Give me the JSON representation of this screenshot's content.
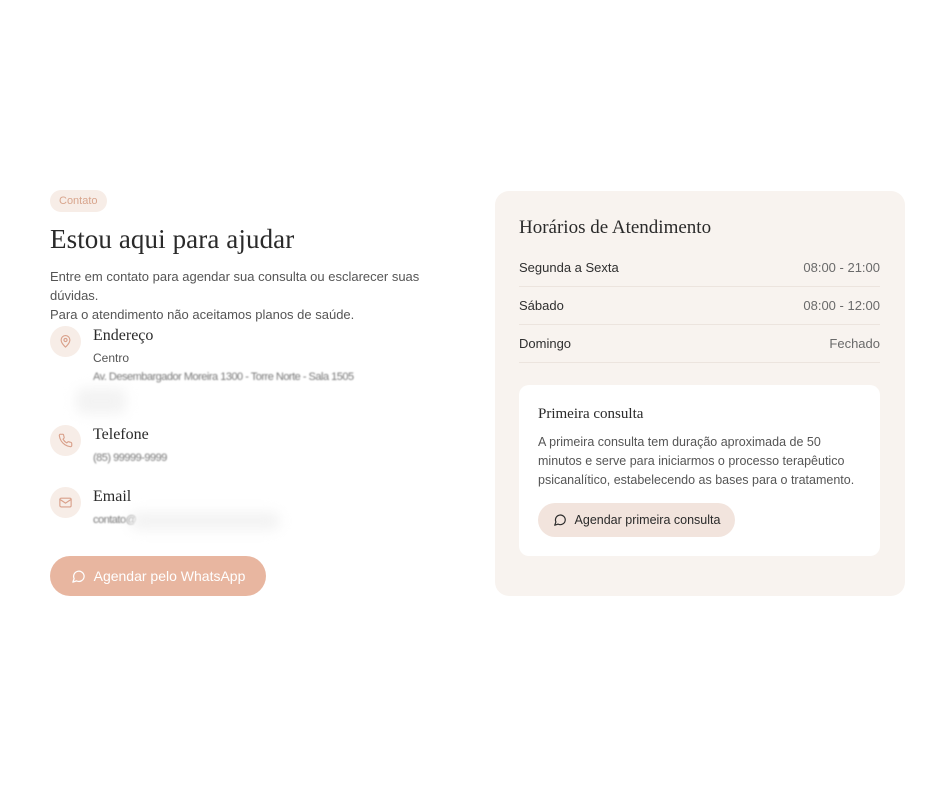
{
  "contact": {
    "badge": "Contato",
    "title": "Estou aqui para ajudar",
    "intro_line1": "Entre em contato para agendar sua consulta ou esclarecer suas dúvidas.",
    "intro_line2": "Para o atendimento não aceitamos planos de saúde.",
    "address": {
      "title": "Endereço",
      "line1": "Centro",
      "line2_redacted": "Av. Desembargador Moreira 1300 - Torre Norte - Sala 1505"
    },
    "phone": {
      "title": "Telefone",
      "value_redacted": "(85) 99999-9999"
    },
    "email": {
      "title": "Email",
      "value_redacted": "contato@"
    },
    "whatsapp_button": "Agendar pelo WhatsApp"
  },
  "hours": {
    "title": "Horários de Atendimento",
    "rows": [
      {
        "day": "Segunda a Sexta",
        "time": "08:00 - 21:00"
      },
      {
        "day": "Sábado",
        "time": "08:00 - 12:00"
      },
      {
        "day": "Domingo",
        "time": "Fechado"
      }
    ]
  },
  "first_visit": {
    "title": "Primeira consulta",
    "text": "A primeira consulta tem duração aproximada de 50 minutos e serve para iniciarmos o processo terapêutico psicanalítico, estabelecendo as bases para o tratamento.",
    "button": "Agendar primeira consulta"
  },
  "colors": {
    "accent": "#e8b6a0",
    "accent_soft": "#f7ede7",
    "card_bg": "#f8f3ef",
    "icon_stroke": "#d9a08a"
  },
  "icons": [
    "map-pin-icon",
    "phone-icon",
    "mail-icon",
    "message-circle-icon"
  ]
}
